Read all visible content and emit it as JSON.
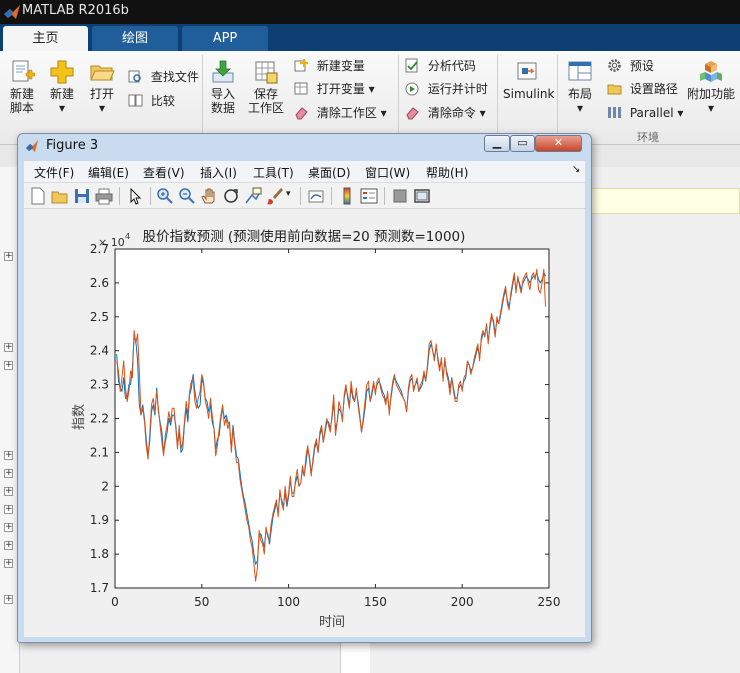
{
  "app": {
    "title": "MATLAB R2016b"
  },
  "tabs": [
    {
      "label": "主页"
    },
    {
      "label": "绘图"
    },
    {
      "label": "APP"
    }
  ],
  "toolstrip": {
    "new_script": {
      "l1": "新建",
      "l2": "脚本"
    },
    "new": {
      "label": "新建"
    },
    "open": {
      "label": "打开"
    },
    "find_files": "查找文件",
    "compare": "比较",
    "import_data": {
      "l1": "导入",
      "l2": "数据"
    },
    "save_workspace": {
      "l1": "保存",
      "l2": "工作区"
    },
    "new_variable": "新建变量",
    "open_variable": "打开变量",
    "clear_workspace": "清除工作区",
    "analyze_code": "分析代码",
    "run_and_time": "运行并计时",
    "clear_commands": "清除命令",
    "simulink": "Simulink",
    "layout": "布局",
    "preferences": "预设",
    "set_path": "设置路径",
    "parallel": "Parallel",
    "addons": "附加功能",
    "group_environment": "环境"
  },
  "figure": {
    "title": "Figure 3",
    "menus": [
      "文件(F)",
      "编辑(E)",
      "查看(V)",
      "插入(I)",
      "工具(T)",
      "桌面(D)",
      "窗口(W)",
      "帮助(H)"
    ]
  },
  "chart_data": {
    "type": "line",
    "title": "股价指数预测 (预测使用前向数据=20 预测数=1000)",
    "xlabel": "时间",
    "ylabel": "指数",
    "y_exponent_label": "× 10",
    "y_exponent_power": "4",
    "xlim": [
      0,
      250
    ],
    "ylim": [
      17000,
      27000
    ],
    "x_ticks": [
      0,
      50,
      100,
      150,
      200,
      250
    ],
    "y_ticks": [
      17000,
      18000,
      19000,
      20000,
      21000,
      22000,
      23000,
      24000,
      25000,
      26000,
      27000
    ],
    "y_tick_labels": [
      "1.7",
      "1.8",
      "1.9",
      "2",
      "2.1",
      "2.2",
      "2.3",
      "2.4",
      "2.5",
      "2.6",
      "2.7"
    ],
    "grid": false,
    "colors": {
      "actual": "#0072bd",
      "predicted": "#d95319"
    },
    "x_step": 1,
    "series": [
      {
        "values": [
          23900,
          23100,
          22900,
          22800,
          23200,
          22600,
          22600,
          23000,
          23000,
          23500,
          24400,
          24300,
          23700,
          22400,
          22100,
          22400,
          22000,
          21400,
          20900,
          21300,
          22200,
          22400,
          22100,
          22900,
          22200,
          21900,
          21600,
          21000,
          21300,
          21600,
          22000,
          21800,
          22100,
          22100,
          21800,
          21200,
          21600,
          21000,
          21100,
          21800,
          22300,
          21900,
          22700,
          22900,
          23300,
          22800,
          22500,
          22300,
          22400,
          23200,
          23000,
          22600,
          22500,
          22200,
          22400,
          21900,
          21700,
          21100,
          21400,
          21500,
          22000,
          22300,
          22000,
          22100,
          21900,
          21800,
          21100,
          21800,
          21300,
          20900,
          20800,
          20400,
          20000,
          19700,
          19500,
          19200,
          18900,
          18600,
          18400,
          18000,
          17700,
          17800,
          18500,
          18600,
          18400,
          18200,
          18700,
          18600,
          18300,
          18700,
          19100,
          19300,
          19500,
          19200,
          19800,
          19600,
          19400,
          19800,
          19400,
          19700,
          20200,
          19800,
          19800,
          20100,
          20300,
          20000,
          20100,
          20500,
          20300,
          20700,
          21100,
          20900,
          20400,
          20700,
          21100,
          21300,
          21000,
          21500,
          21700,
          21300,
          21600,
          21900,
          21900,
          21700,
          22000,
          22500,
          21700,
          21900,
          22300,
          22200,
          22000,
          22600,
          22900,
          22700,
          22400,
          22900,
          22600,
          22500,
          22800,
          22500,
          22100,
          21600,
          21900,
          22300,
          22800,
          22900,
          22500,
          22700,
          23000,
          22800,
          23000,
          23100,
          23000,
          22800,
          22700,
          22500,
          22700,
          22200,
          22600,
          23000,
          23200,
          23100,
          23000,
          22900,
          22800,
          22600,
          22500,
          22200,
          22800,
          23100,
          23200,
          22900,
          23000,
          23100,
          22800,
          22900,
          23000,
          23300,
          23100,
          23500,
          24000,
          24200,
          24000,
          23800,
          24100,
          23800,
          23500,
          23700,
          23200,
          23700,
          23400,
          23200,
          22900,
          23200,
          22900,
          22600,
          22600,
          22900,
          23000,
          22900,
          23100,
          23200,
          23600,
          23600,
          23400,
          23500,
          23700,
          23900,
          24100,
          23800,
          24300,
          24500,
          24500,
          24700,
          24300,
          24700,
          25000,
          24900,
          24500,
          24900,
          24800,
          25000,
          25300,
          25600,
          25800,
          25500,
          25300,
          25600,
          25900,
          26200,
          25800,
          26100,
          26000,
          25800,
          26000,
          26100,
          26200,
          26100,
          26000,
          26100,
          26200,
          26200,
          26300,
          26100,
          26000,
          26100,
          26300,
          26200
        ]
      },
      {
        "values": [
          23700,
          23400,
          22800,
          23200,
          23700,
          22900,
          22500,
          22800,
          23400,
          23200,
          24600,
          24200,
          24500,
          23400,
          22100,
          22300,
          21900,
          21200,
          20800,
          21500,
          22400,
          22600,
          22200,
          22800,
          22300,
          21800,
          21300,
          20900,
          21500,
          21800,
          22200,
          21900,
          22300,
          22300,
          21700,
          21100,
          21800,
          21100,
          21300,
          21900,
          22500,
          22100,
          22800,
          23100,
          23200,
          22500,
          22300,
          22600,
          22800,
          23300,
          23100,
          22500,
          22300,
          22000,
          22600,
          22100,
          21700,
          20900,
          21200,
          21700,
          22100,
          22400,
          21800,
          22000,
          21700,
          21900,
          21000,
          21700,
          21200,
          20700,
          20700,
          20200,
          19900,
          19600,
          19300,
          19000,
          18800,
          18400,
          18200,
          17700,
          17200,
          17600,
          18700,
          18400,
          18300,
          18000,
          18800,
          18500,
          18400,
          18900,
          19200,
          19400,
          19600,
          19100,
          19900,
          19500,
          19300,
          20000,
          19500,
          19800,
          20300,
          19700,
          19700,
          20200,
          20500,
          20000,
          20100,
          20600,
          20300,
          20900,
          21200,
          20800,
          20300,
          20800,
          21200,
          21400,
          21000,
          21600,
          21800,
          21300,
          21700,
          22000,
          21800,
          21600,
          22100,
          22700,
          21500,
          21900,
          22500,
          22300,
          21900,
          22700,
          23000,
          22600,
          22300,
          23100,
          22700,
          22500,
          22900,
          22400,
          22000,
          21600,
          22000,
          22500,
          23000,
          23100,
          22500,
          22800,
          23100,
          22700,
          23100,
          23200,
          22900,
          22700,
          22600,
          22400,
          22800,
          22100,
          22700,
          23100,
          23300,
          23000,
          22900,
          22800,
          22700,
          22600,
          22500,
          22200,
          22900,
          23200,
          23300,
          22800,
          23000,
          23200,
          22800,
          23000,
          23100,
          23400,
          23100,
          23600,
          24200,
          24300,
          24000,
          23700,
          24200,
          23700,
          23400,
          23800,
          23100,
          23800,
          23300,
          23100,
          22700,
          23200,
          22800,
          22500,
          22500,
          23000,
          23100,
          22800,
          23200,
          23300,
          23700,
          23600,
          23300,
          23500,
          23800,
          24000,
          24200,
          23700,
          24400,
          24600,
          24400,
          24800,
          24200,
          24800,
          25100,
          24800,
          24400,
          25000,
          24800,
          25100,
          25400,
          25700,
          25900,
          25400,
          25200,
          25700,
          26000,
          26300,
          25700,
          26200,
          25900,
          25700,
          26100,
          26200,
          26300,
          26000,
          25800,
          26200,
          26300,
          26100,
          26400,
          25800,
          25700,
          26000,
          26400,
          25300
        ]
      }
    ]
  }
}
